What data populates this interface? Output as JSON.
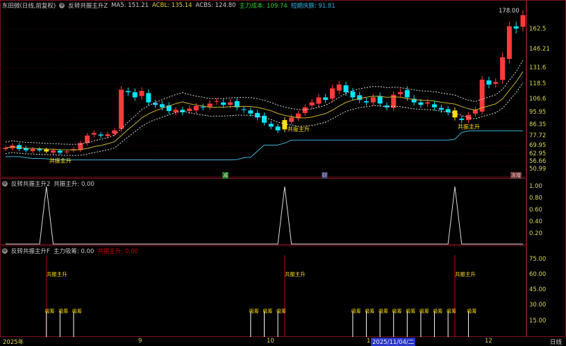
{
  "header": {
    "title": "东田微(日线,前复权)",
    "indicator": "反转共振主升Z",
    "ma5": "MA5: 151.21",
    "acbl": "ACBL: 135.14",
    "acbs": "ACBS: 124.80",
    "cost": "主力成本: 109.74",
    "short": "短期庆豚: 91.81"
  },
  "panel2": {
    "indicator": "反转共振主升2",
    "value": "共振主升: 0.00",
    "axis": [
      "1.00",
      "0.80",
      "0.60",
      "0.40",
      "0.20"
    ]
  },
  "panel3": {
    "indicator": "反转共振主升F",
    "value1": "主力吸筹: 0.00",
    "value2": "共振主升: 0.00",
    "axis": [
      "75.00",
      "60.00",
      "45.00",
      "30.00",
      "15.00"
    ],
    "signal_label": "共振主升",
    "accum_label": "吸筹"
  },
  "main_axis": [
    "178.00",
    "162.5",
    "146.21",
    "131.6",
    "118.5",
    "106.6",
    "95.95",
    "86.35",
    "77.72",
    "69.95",
    "62.95",
    "56.66",
    "50.99"
  ],
  "max_label": "178.00",
  "signal_text": "共振主升",
  "markers": {
    "m1": "减",
    "m2": "财",
    "m3": "冻增"
  },
  "time_axis": {
    "t0": "2025年",
    "t1": "9",
    "t2": "10",
    "t3": "1",
    "cursor": "2025/11/04/二",
    "t4": "12",
    "period": "日线"
  },
  "colors": {
    "up": "#ff3b3b",
    "down": "#00e5ff",
    "signal": "#ffe000",
    "support": "#3fb6e0",
    "ma": "#c8b432",
    "frame": "#7a1420"
  },
  "chart_data": {
    "type": "candlestick",
    "closes": [
      68,
      70,
      67,
      66,
      67,
      66,
      65,
      66,
      64,
      65,
      67,
      72,
      78,
      80,
      78,
      79,
      82,
      114,
      112,
      108,
      113,
      104,
      102,
      100,
      97,
      98,
      96,
      99,
      101,
      100,
      103,
      105,
      102,
      104,
      100,
      98,
      95,
      92,
      88,
      85,
      82,
      90,
      92,
      95,
      100,
      104,
      108,
      106,
      115,
      118,
      112,
      108,
      106,
      104,
      108,
      103,
      100,
      110,
      112,
      108,
      104,
      102,
      104,
      100,
      98,
      96,
      92,
      90,
      94,
      98,
      122,
      118,
      120,
      140,
      165,
      163,
      175
    ],
    "signal_indices": [
      6,
      41,
      66
    ],
    "accum_indices": [
      8,
      10,
      12,
      38,
      40,
      42,
      57,
      59,
      61,
      63,
      65,
      67,
      70,
      42,
      53,
      55,
      57
    ]
  }
}
